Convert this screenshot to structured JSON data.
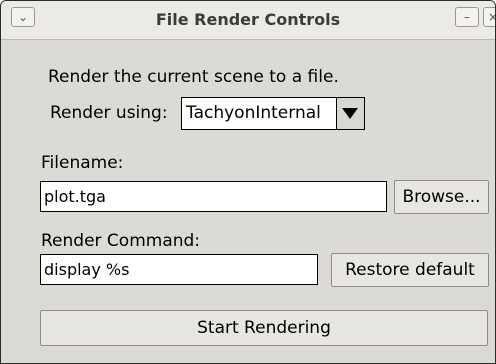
{
  "window": {
    "title": "File Render Controls",
    "menu_icon": "chevron-down-icon",
    "minimize_icon": "minimize-icon",
    "close_icon": "close-icon"
  },
  "description": "Render the current scene to a file.",
  "render_using": {
    "label": "Render using:",
    "selected": "TachyonInternal"
  },
  "filename": {
    "label": "Filename:",
    "value": "plot.tga",
    "browse_label": "Browse..."
  },
  "render_command": {
    "label": "Render Command:",
    "value": "display %s",
    "restore_label": "Restore default"
  },
  "start_label": "Start Rendering"
}
